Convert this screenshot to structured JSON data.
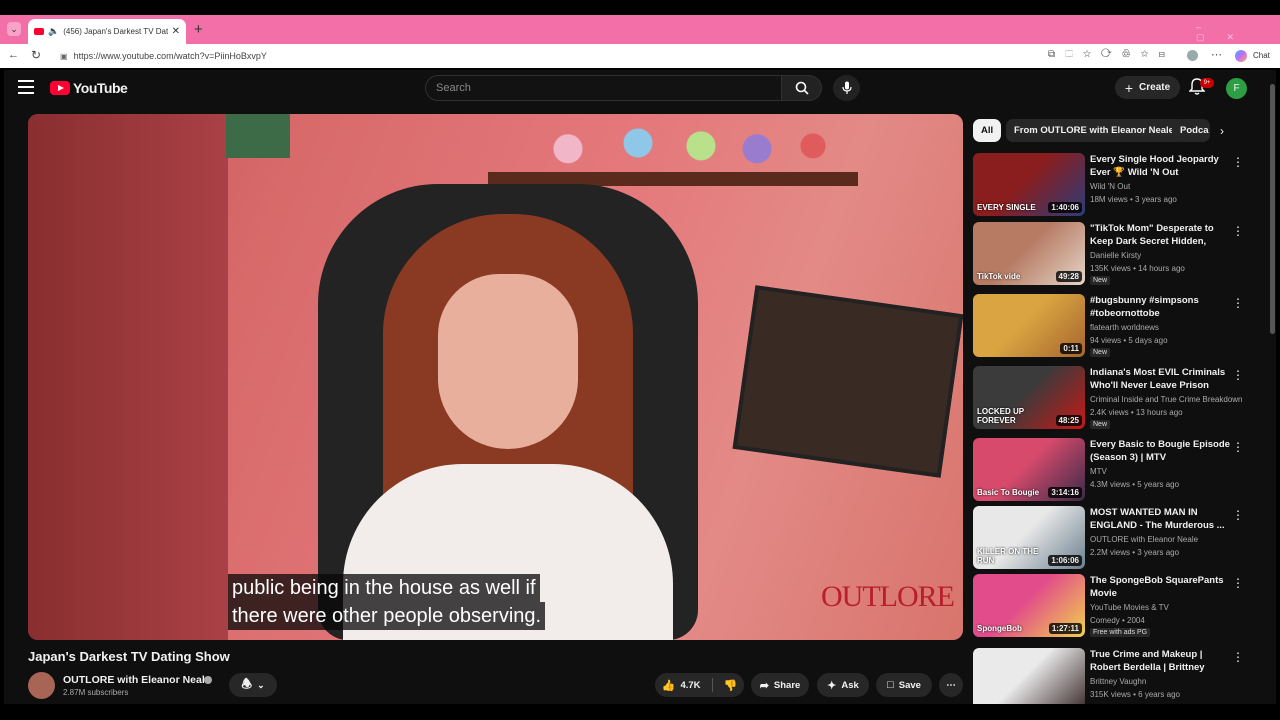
{
  "browser": {
    "tab_title": "(456) Japan's Darkest TV Datin",
    "url": "https://www.youtube.com/watch?v=PiinHoBxvpY",
    "copilot_label": "Chat"
  },
  "masthead": {
    "logo_text": "YouTube",
    "search_placeholder": "Search",
    "create_label": "Create",
    "notif_count": "9+",
    "avatar_letter": "F"
  },
  "video": {
    "caption_line1": "public being in the house as well if",
    "caption_line2": "there were other people observing.",
    "watermark": "OUTLORE",
    "title": "Japan's Darkest TV Dating Show",
    "channel": "OUTLORE with Eleanor Neale",
    "subscribers": "2.87M subscribers",
    "likes": "4.7K",
    "share_label": "Share",
    "ask_label": "Ask",
    "save_label": "Save"
  },
  "chips": [
    "All",
    "From OUTLORE with Eleanor Neale",
    "Podca"
  ],
  "recommendations": [
    {
      "title": "Every Single Hood Jeopardy Ever 🏆 Wild 'N Out",
      "channel": "Wild 'N Out",
      "meta": "18M views • 3 years ago",
      "duration": "1:40:06",
      "thumb_text": "EVERY SINGLE",
      "badge": "",
      "colors": [
        "#8a1d1d",
        "#2c3d7a"
      ]
    },
    {
      "title": "\"TikTok Mom\" Desperate to Keep Dark Secret Hidden, then...",
      "channel": "Danielle Kirsty",
      "meta": "135K views • 14 hours ago",
      "duration": "49:28",
      "thumb_text": "TikTok vide",
      "badge": "New",
      "colors": [
        "#b77b64",
        "#e4d6c8"
      ]
    },
    {
      "title": "#bugsbunny #simpsons #tobeornottobe",
      "channel": "flatearth worldnews",
      "meta": "94 views • 5 days ago",
      "duration": "0:11",
      "thumb_text": "",
      "badge": "New",
      "colors": [
        "#d9a441",
        "#a5652f"
      ]
    },
    {
      "title": "Indiana's Most EVIL Criminals Who'll Never Leave Prison",
      "channel": "Criminal Inside and True Crime Breakdown",
      "meta": "2.4K views • 13 hours ago",
      "duration": "48:25",
      "thumb_text": "LOCKED UP FOREVER",
      "badge": "New",
      "colors": [
        "#3b3b3b",
        "#c81818"
      ]
    },
    {
      "title": "Every Basic to Bougie Episode (Season 3) | MTV",
      "channel": "MTV",
      "meta": "4.3M views • 5 years ago",
      "duration": "3:14:16",
      "thumb_text": "Basic To Bougie",
      "badge": "",
      "colors": [
        "#d74a6b",
        "#3a2a4a"
      ]
    },
    {
      "title": "MOST WANTED MAN IN ENGLAND - The Murderous ...",
      "channel": "OUTLORE with Eleanor Neale",
      "meta": "2.2M views • 3 years ago",
      "duration": "1:06:06",
      "thumb_text": "KILLER ON THE RUN",
      "badge": "",
      "colors": [
        "#e8e8e8",
        "#6a7f8f"
      ]
    },
    {
      "title": "The SpongeBob SquarePants Movie",
      "channel": "YouTube Movies & TV",
      "meta": "Comedy • 2004",
      "duration": "1:27:11",
      "thumb_text": "SpongeBob",
      "badge": "Free with ads  PG",
      "colors": [
        "#e24c8a",
        "#f0d34b"
      ]
    },
    {
      "title": "True Crime and Makeup | Robert Berdella | Brittney Vaughn",
      "channel": "Brittney Vaughn",
      "meta": "315K views • 6 years ago",
      "duration": "",
      "thumb_text": "",
      "badge": "",
      "colors": [
        "#eaeaea",
        "#3a2a2a"
      ]
    }
  ]
}
